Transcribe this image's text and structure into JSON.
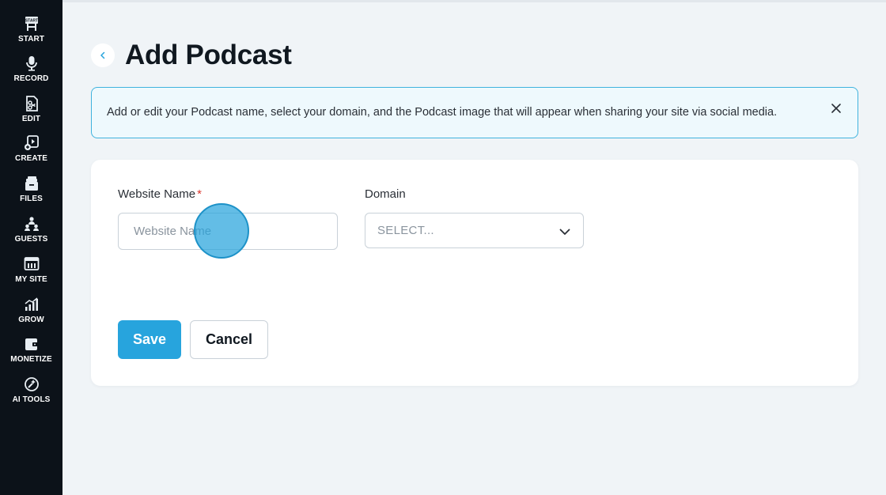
{
  "sidebar": {
    "items": [
      {
        "label": "START",
        "icon": "start-sign-icon"
      },
      {
        "label": "RECORD",
        "icon": "microphone-icon"
      },
      {
        "label": "EDIT",
        "icon": "edit-document-icon"
      },
      {
        "label": "CREATE",
        "icon": "create-video-icon"
      },
      {
        "label": "FILES",
        "icon": "files-icon"
      },
      {
        "label": "GUESTS",
        "icon": "guests-icon"
      },
      {
        "label": "MY SITE",
        "icon": "website-icon"
      },
      {
        "label": "GROW",
        "icon": "growth-chart-icon"
      },
      {
        "label": "MONETIZE",
        "icon": "wallet-icon"
      },
      {
        "label": "AI TOOLS",
        "icon": "ai-tools-icon"
      }
    ]
  },
  "header": {
    "title": "Add Podcast",
    "back_icon": "chevron-left-icon"
  },
  "info_banner": {
    "text": "Add or edit your Podcast name, select your domain, and the Podcast image that will appear when sharing your site via social media.",
    "close_icon": "close-icon"
  },
  "form": {
    "website_name": {
      "label": "Website Name",
      "required_mark": "*",
      "value": "",
      "placeholder": "Website Name"
    },
    "domain": {
      "label": "Domain",
      "selected": "SELECT...",
      "icon": "chevron-down-icon"
    },
    "save_label": "Save",
    "cancel_label": "Cancel"
  },
  "colors": {
    "sidebar_bg": "#0c1219",
    "page_bg": "#f0f4f7",
    "accent": "#27a4dd",
    "required": "#d9342b",
    "banner_border": "#3fb3de"
  }
}
